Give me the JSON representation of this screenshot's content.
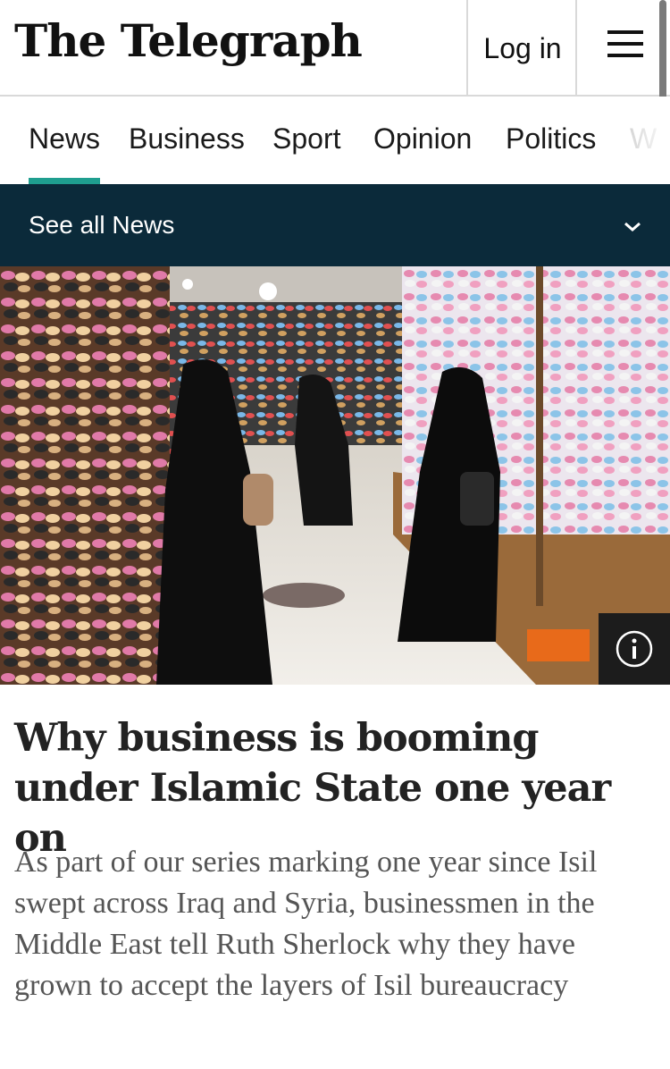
{
  "header": {
    "logo_text": "The Telegraph",
    "login_label": "Log in",
    "menu_icon": "hamburger-icon"
  },
  "nav": {
    "items": [
      {
        "label": "News",
        "active": true
      },
      {
        "label": "Business"
      },
      {
        "label": "Sport"
      },
      {
        "label": "Opinion"
      },
      {
        "label": "Politics"
      },
      {
        "label": "W"
      }
    ]
  },
  "subnav": {
    "label": "See all News",
    "icon": "chevron-down-icon"
  },
  "article": {
    "info_icon": "info-icon",
    "headline": "Why business is booming under Islamic State one year on",
    "standfirst": "As part of our series marking one year since Isil swept across Iraq and Syria, businessmen in the Middle East tell Ruth Sherlock why they have grown to accept the layers of Isil bureaucracy"
  },
  "colors": {
    "accent": "#1f9e8f",
    "subnav_bg": "#0b2a3a"
  }
}
